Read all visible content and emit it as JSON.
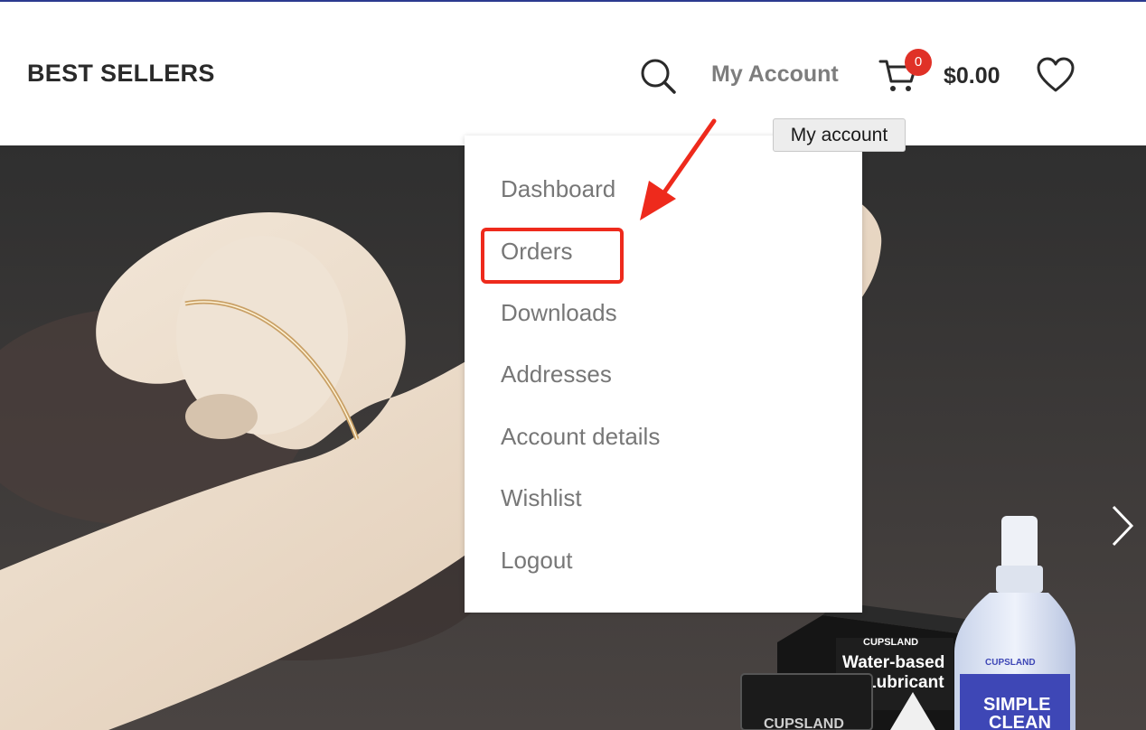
{
  "header": {
    "brand": "BEST SELLERS",
    "search_icon": "search-icon",
    "account_label": "My Account",
    "cart": {
      "count": "0",
      "total": "$0.00",
      "icon": "cart-icon"
    },
    "wishlist_icon": "heart-icon"
  },
  "tooltip": {
    "text": "My account"
  },
  "account_menu": {
    "items": [
      {
        "label": "Dashboard"
      },
      {
        "label": "Orders"
      },
      {
        "label": "Downloads"
      },
      {
        "label": "Addresses"
      },
      {
        "label": "Account details"
      },
      {
        "label": "Wishlist"
      },
      {
        "label": "Logout"
      }
    ]
  },
  "hero": {
    "product_labels": {
      "brand": "CUPSLAND",
      "sachet_line1": "Water-based",
      "sachet_line2": "Lubricant",
      "bottle_brand": "CUPSLAND",
      "bottle_line1": "SIMPLE",
      "bottle_line2": "CLEAN"
    },
    "next_icon": "chevron-right-icon"
  },
  "annotation": {
    "color": "#ee2a1c",
    "target": "Orders"
  }
}
